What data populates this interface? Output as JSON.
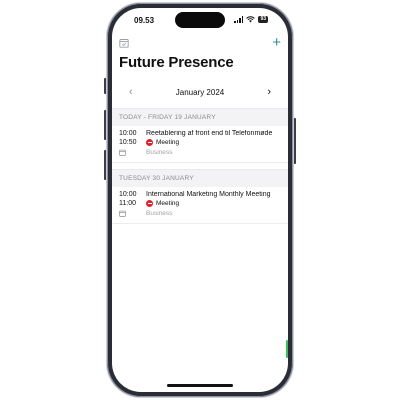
{
  "status_bar": {
    "time": "09.53",
    "battery": "93"
  },
  "header": {
    "title": "Future Presence",
    "add_label": "+"
  },
  "month_nav": {
    "label": "January 2024",
    "prev": "‹",
    "next": "›"
  },
  "sections": [
    {
      "heading": "TODAY - FRIDAY 19 JANUARY",
      "events": [
        {
          "start": "10:00",
          "end": "10:50",
          "title": "Reetablering af front end til Telefonmøde",
          "type": "Meeting",
          "category": "Business"
        }
      ]
    },
    {
      "heading": "TUESDAY 30 JANUARY",
      "events": [
        {
          "start": "10:00",
          "end": "11:00",
          "title": "International Marketing Monthly Meeting",
          "type": "Meeting",
          "category": "Business"
        }
      ]
    }
  ],
  "colors": {
    "accent": "#2f8aa4",
    "dnd": "#d8252b",
    "section_bg": "#f3f3f5"
  },
  "icons": {
    "calendar": "calendar-icon",
    "add": "plus-icon",
    "status": "do-not-disturb-icon"
  }
}
